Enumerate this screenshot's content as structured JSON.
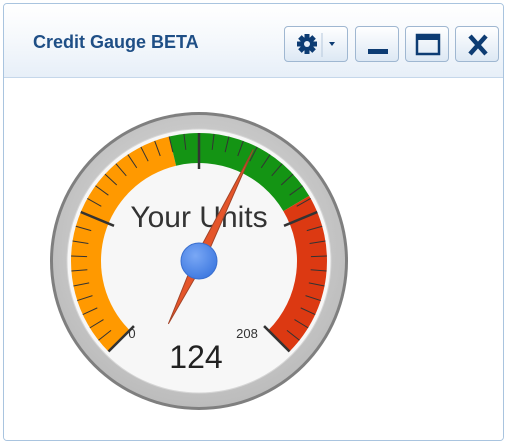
{
  "window": {
    "title": "Credit Gauge BETA"
  },
  "toolbar": {
    "buttons": [
      {
        "name": "settings-menu-button",
        "icon": "gear-with-dropdown-icon"
      },
      {
        "name": "minimize-button",
        "icon": "minimize-icon"
      },
      {
        "name": "maximize-button",
        "icon": "maximize-icon"
      },
      {
        "name": "close-button",
        "icon": "close-icon"
      }
    ]
  },
  "gauge": {
    "label": "Your Units",
    "min": 0,
    "max": 208,
    "min_label": "0",
    "max_label": "208",
    "value": 124,
    "value_label": "124",
    "bands": [
      {
        "from": 0,
        "to": 0.45,
        "color": "#ff9900"
      },
      {
        "from": 0.45,
        "to": 0.72,
        "color": "#149414"
      },
      {
        "from": 0.72,
        "to": 1.0,
        "color": "#dc3912"
      }
    ],
    "colors": {
      "needle": "#e5552a",
      "hub": "#4684ee",
      "face": "#f7f7f7",
      "ring": "#cccccc"
    }
  }
}
